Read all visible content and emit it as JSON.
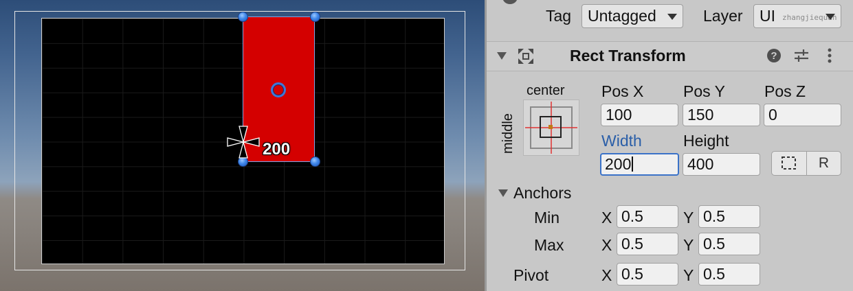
{
  "scene": {
    "size_label": "200"
  },
  "inspector": {
    "tag": {
      "label": "Tag",
      "value": "Untagged"
    },
    "layer": {
      "label": "Layer",
      "value": "UI",
      "watermark": "zhangjiequan"
    },
    "component": {
      "title": "Rect Transform",
      "anchor_preset": {
        "top_label": "center",
        "side_label": "middle"
      },
      "pos_x": {
        "label": "Pos X",
        "value": "100"
      },
      "pos_y": {
        "label": "Pos Y",
        "value": "150"
      },
      "pos_z": {
        "label": "Pos Z",
        "value": "0"
      },
      "width": {
        "label": "Width",
        "value": "200"
      },
      "height": {
        "label": "Height",
        "value": "400"
      },
      "raw_edit_button_label": "R",
      "anchors": {
        "label": "Anchors",
        "min": {
          "label": "Min",
          "x_label": "X",
          "x": "0.5",
          "y_label": "Y",
          "y": "0.5"
        },
        "max": {
          "label": "Max",
          "x_label": "X",
          "x": "0.5",
          "y_label": "Y",
          "y": "0.5"
        }
      },
      "pivot": {
        "label": "Pivot",
        "x_label": "X",
        "x": "0.5",
        "y_label": "Y",
        "y": "0.5"
      }
    }
  },
  "colors": {
    "selected_rect": "#d40000",
    "handle": "#3f86e8",
    "focused_label": "#2a5ea8"
  }
}
